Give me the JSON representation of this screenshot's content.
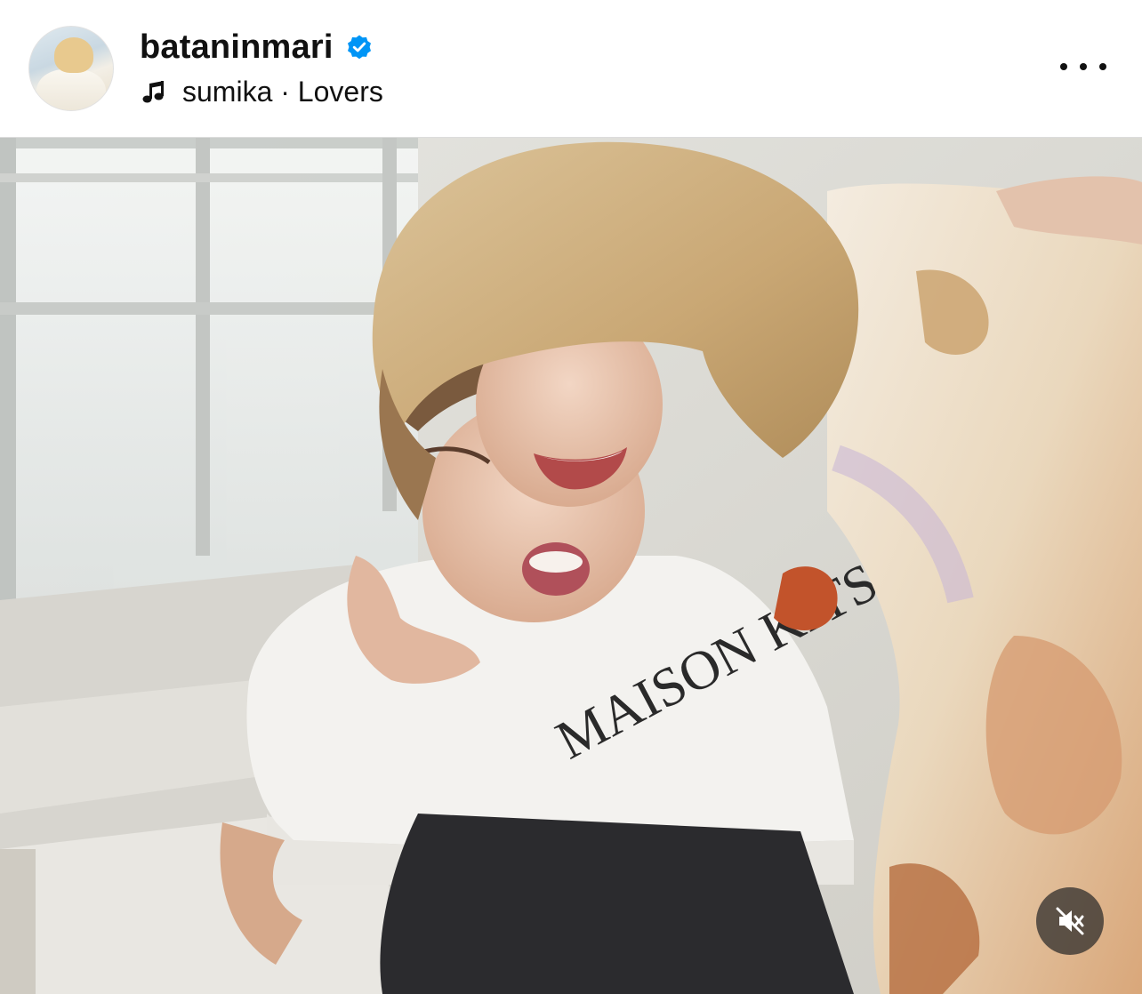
{
  "post": {
    "username": "bataninmari",
    "verified": true,
    "music": {
      "artist": "sumika",
      "separator": "·",
      "track": "Lovers",
      "display": "sumika · Lovers"
    }
  },
  "media": {
    "type": "video",
    "muted": true,
    "tshirt_print": "MAISON KITSUNE"
  },
  "icons": {
    "verified": "verified-badge-icon",
    "music": "music-note-icon",
    "more": "more-options-icon",
    "mute": "speaker-muted-icon"
  },
  "colors": {
    "verified_blue": "#0095f6",
    "text": "#111111",
    "mute_bg": "#282828"
  }
}
